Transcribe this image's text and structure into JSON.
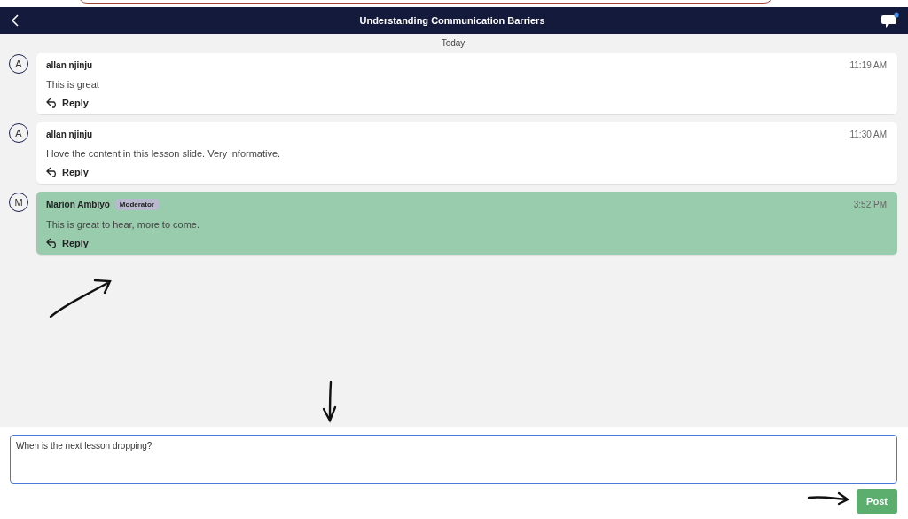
{
  "header": {
    "title": "Understanding Communication Barriers",
    "notification_dot": true
  },
  "date_divider": "Today",
  "messages": [
    {
      "initial": "A",
      "author": "allan njinju",
      "time": "11:19 AM",
      "text": "This is great",
      "reply": "Reply",
      "highlighted": false
    },
    {
      "initial": "A",
      "author": "allan njinju",
      "time": "11:30 AM",
      "text": "I love the content in this lesson slide. Very informative.",
      "reply": "Reply",
      "highlighted": false
    },
    {
      "initial": "M",
      "author": "Marion Ambiyo",
      "badge": "Moderator",
      "time": "3:52 PM",
      "text": "This is great to hear, more to come.",
      "reply": "Reply",
      "highlighted": true
    }
  ],
  "composer": {
    "value": "When is the next lesson dropping?",
    "button": "Post"
  }
}
